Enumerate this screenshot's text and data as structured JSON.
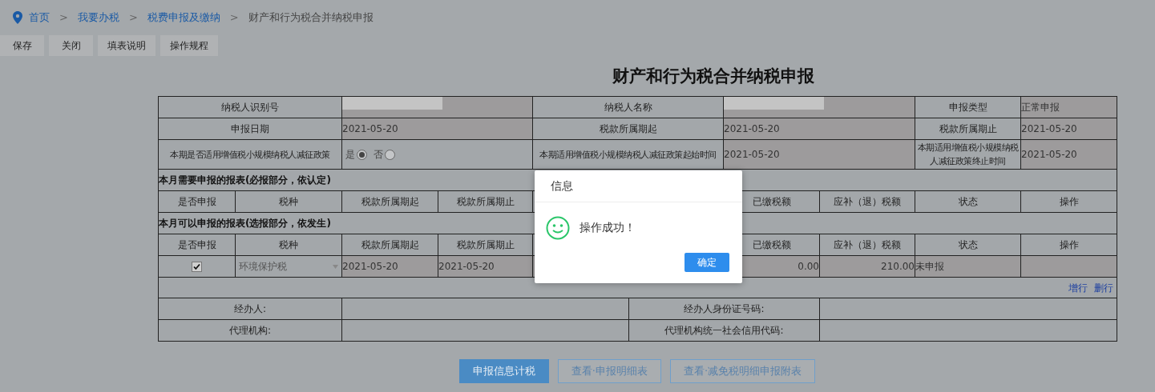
{
  "breadcrumb": [
    {
      "label": "首页",
      "kind": "link"
    },
    {
      "label": "我要办税",
      "kind": "link"
    },
    {
      "label": "税费申报及缴纳",
      "kind": "link"
    },
    {
      "label": "财产和行为税合并纳税申报",
      "kind": "current"
    }
  ],
  "breadcrumb_separator": ">",
  "toolbar": [
    "保存",
    "关闭",
    "填表说明",
    "操作规程"
  ],
  "title": "财产和行为税合并纳税申报",
  "info_rows": [
    [
      {
        "kind": "label",
        "text": "纳税人识别号"
      },
      {
        "kind": "masked"
      },
      {
        "kind": "label",
        "text": "纳税人名称"
      },
      {
        "kind": "masked"
      },
      {
        "kind": "label",
        "text": "申报类型"
      },
      {
        "kind": "value",
        "text": "正常申报"
      }
    ],
    [
      {
        "kind": "label",
        "text": "申报日期"
      },
      {
        "kind": "value",
        "text": "2021-05-20"
      },
      {
        "kind": "label",
        "text": "税款所属期起"
      },
      {
        "kind": "value",
        "text": "2021-05-20"
      },
      {
        "kind": "label",
        "text": "税款所属期止"
      },
      {
        "kind": "value",
        "text": "2021-05-20"
      }
    ],
    [
      {
        "kind": "label",
        "text": "本期是否适用增值税小规模纳税人减征政策"
      },
      {
        "kind": "radio",
        "disabled": true,
        "options": [
          {
            "label": "是",
            "selected": true
          },
          {
            "label": "否",
            "selected": false
          }
        ]
      },
      {
        "kind": "label",
        "text": "本期适用增值税小规模纳税人减征政策起始时间"
      },
      {
        "kind": "value",
        "text": "2021-05-20"
      },
      {
        "kind": "label",
        "text": "本期适用增值税小规模纳税人减征政策终止时间"
      },
      {
        "kind": "value",
        "text": "2021-05-20"
      }
    ]
  ],
  "sections": [
    {
      "title": "本月需要申报的报表(必报部分，依认定)",
      "columns": [
        "是否申报",
        "税种",
        "税款所属期起",
        "税款所属期止",
        "已缴税额",
        "应补（退）税额",
        "状态",
        "操作"
      ]
    },
    {
      "title": "本月可以申报的报表(选报部分，依发生)",
      "columns": [
        "是否申报",
        "税种",
        "税款所属期起",
        "税款所属期止",
        "已缴税额",
        "应补（退）税额",
        "状态",
        "操作"
      ],
      "rows": [
        {
          "checked": true,
          "tax": "环境保护税",
          "tax_disabled": true,
          "start": "2021-05-20",
          "end": "2021-05-20",
          "paid": "0.00",
          "due": "210.00",
          "status": "未申报"
        }
      ]
    }
  ],
  "row_actions": [
    "增行",
    "删行"
  ],
  "agent_rows": [
    [
      "经办人:",
      "经办人身份证号码:"
    ],
    [
      "代理机构:",
      "代理机构统一社会信用代码:"
    ]
  ],
  "bottom_buttons": [
    {
      "label": "申报信息计税",
      "primary": true
    },
    {
      "label": "查看·申报明细表",
      "primary": false
    },
    {
      "label": "查看·减免税明细申报附表",
      "primary": false
    }
  ],
  "dialog": {
    "title": "信息",
    "message": "操作成功！",
    "button": "确定"
  }
}
